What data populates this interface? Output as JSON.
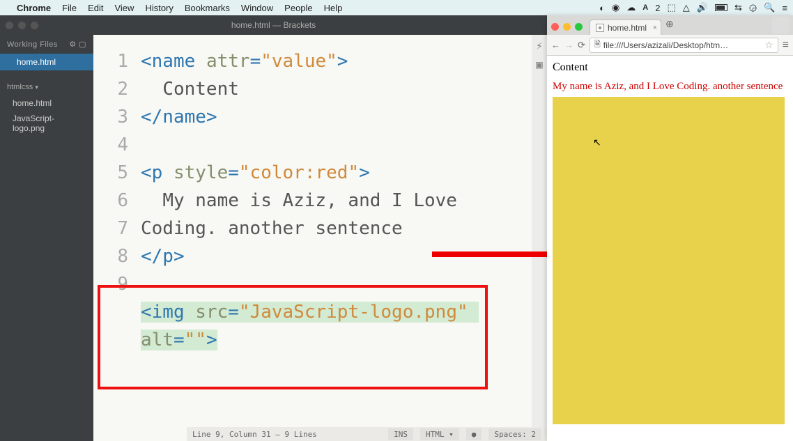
{
  "menubar": {
    "app": "Chrome",
    "items": [
      "File",
      "Edit",
      "View",
      "History",
      "Bookmarks",
      "Window",
      "People",
      "Help"
    ]
  },
  "brackets": {
    "title": "home.html — Brackets",
    "working_files_label": "Working Files",
    "working_files": [
      "home.html"
    ],
    "project_name": "htmlcss",
    "project_files": [
      "home.html",
      "JavaScript-logo.png"
    ],
    "lines": [
      {
        "n": "1",
        "parts": [
          {
            "c": "tag",
            "t": "<name"
          },
          {
            "c": "txt",
            "t": " "
          },
          {
            "c": "attr",
            "t": "attr"
          },
          {
            "c": "tag",
            "t": "="
          },
          {
            "c": "str",
            "t": "\"value\""
          },
          {
            "c": "tag",
            "t": ">"
          }
        ]
      },
      {
        "n": "2",
        "parts": [
          {
            "c": "txt",
            "t": "  Content"
          }
        ]
      },
      {
        "n": "3",
        "parts": [
          {
            "c": "tag",
            "t": "</name>"
          }
        ]
      },
      {
        "n": "4",
        "parts": [
          {
            "c": "txt",
            "t": ""
          }
        ]
      },
      {
        "n": "5",
        "parts": [
          {
            "c": "tag",
            "t": "<p"
          },
          {
            "c": "txt",
            "t": " "
          },
          {
            "c": "attr",
            "t": "style"
          },
          {
            "c": "tag",
            "t": "="
          },
          {
            "c": "str",
            "t": "\"color:red\""
          },
          {
            "c": "tag",
            "t": ">"
          }
        ]
      },
      {
        "n": "6",
        "parts": [
          {
            "c": "txt",
            "t": "  My name is Aziz, and I Love Coding. another sentence"
          }
        ]
      },
      {
        "n": "7",
        "parts": [
          {
            "c": "tag",
            "t": "</p>"
          }
        ]
      },
      {
        "n": "8",
        "parts": [
          {
            "c": "txt",
            "t": ""
          }
        ]
      },
      {
        "n": "9",
        "sel": true,
        "parts": [
          {
            "c": "tag",
            "t": "<img"
          },
          {
            "c": "txt",
            "t": " "
          },
          {
            "c": "attr",
            "t": "src"
          },
          {
            "c": "tag",
            "t": "="
          },
          {
            "c": "str",
            "t": "\"JavaScript-logo.png\""
          },
          {
            "c": "txt",
            "t": " "
          },
          {
            "c": "attr",
            "t": "alt"
          },
          {
            "c": "tag",
            "t": "="
          },
          {
            "c": "str",
            "t": "\"\""
          },
          {
            "c": "tag",
            "t": ">"
          }
        ]
      }
    ],
    "status_left": "Line 9, Column 31 — 9 Lines",
    "status_ins": "INS",
    "status_lang": "HTML",
    "status_spaces": "Spaces: 2"
  },
  "chrome": {
    "tab_title": "home.html",
    "url": "file:///Users/azizali/Desktop/htm…",
    "content_text": "Content",
    "paragraph_text": "My name is Aziz, and I Love Coding. another sentence"
  }
}
